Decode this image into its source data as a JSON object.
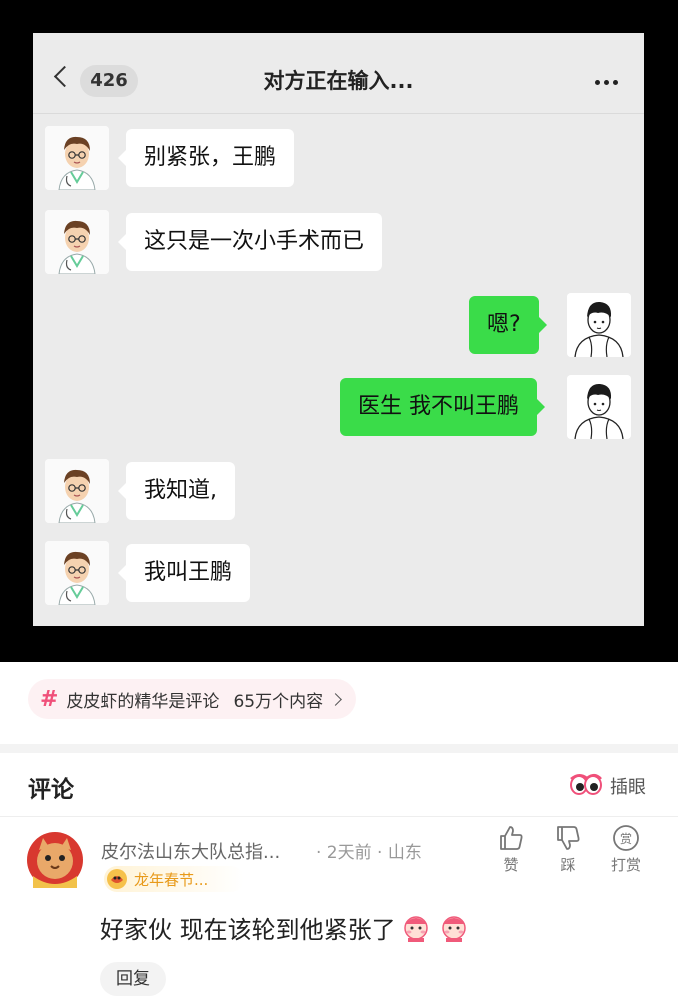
{
  "chat": {
    "unread_count": "426",
    "title": "对方正在输入...",
    "messages": [
      {
        "side": "left",
        "text": "别紧张，王鹏"
      },
      {
        "side": "left",
        "text": "这只是一次小手术而已"
      },
      {
        "side": "right",
        "text": "嗯?"
      },
      {
        "side": "right",
        "text": "医生 我不叫王鹏"
      },
      {
        "side": "left",
        "text": "我知道,"
      },
      {
        "side": "left",
        "text": "我叫王鹏"
      }
    ]
  },
  "topic": {
    "label": "皮皮虾的精华是评论",
    "count": "65万个内容"
  },
  "comments_header": {
    "title": "评论",
    "eye_label": "插眼"
  },
  "comment": {
    "username": "皮尔法山东大队总指...",
    "meta": "· 2天前 · 山东",
    "badge": "龙年春节...",
    "text": "好家伙  现在该轮到他紧张了",
    "reply_label": "回复",
    "actions": {
      "like": "赞",
      "dislike": "踩",
      "tip": "打赏"
    }
  },
  "colors": {
    "accent_pink": "#f0507a",
    "bubble_green": "#3adc49",
    "chat_bg": "#ebebeb"
  },
  "icons": [
    "back-chevron-icon",
    "more-icon",
    "doctor-avatar",
    "boy-avatar",
    "hash-icon",
    "chevron-right-icon",
    "eye-icon",
    "cat-avatar",
    "dragon-badge-icon",
    "thumbs-up-icon",
    "thumbs-down-icon",
    "tip-icon",
    "blush-face-icon"
  ]
}
